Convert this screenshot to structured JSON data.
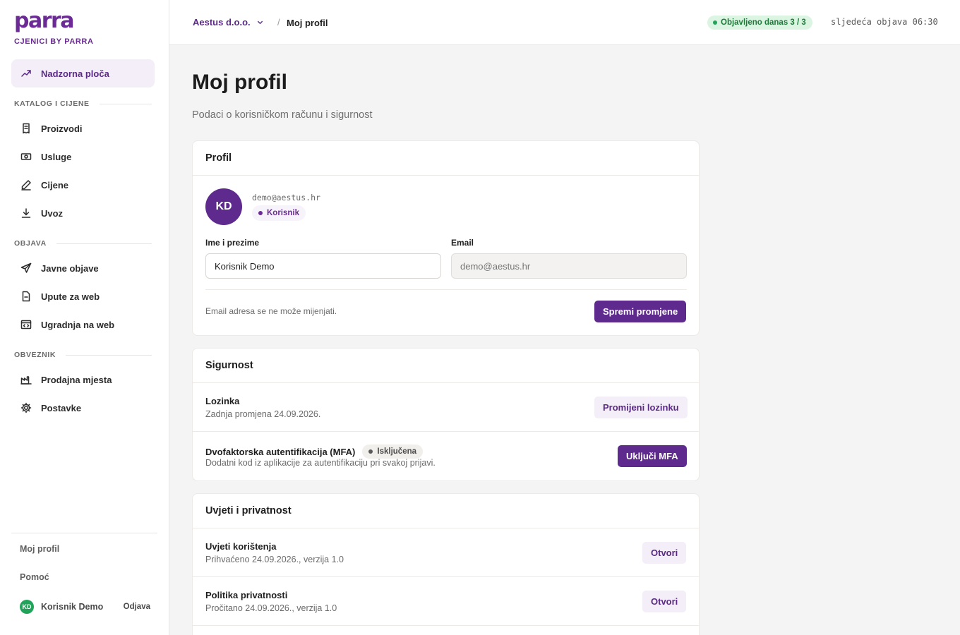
{
  "brand": {
    "logo": "parra",
    "subtitle": "CJENICI BY PARRA",
    "accent": "#5e2a8d"
  },
  "sidebar": {
    "dashboard": {
      "label": "Nadzorna ploča",
      "icon": "trend-up-icon"
    },
    "sections": [
      {
        "label": "KATALOG I CIJENE",
        "items": [
          {
            "label": "Proizvodi",
            "icon": "receipt-icon"
          },
          {
            "label": "Usluge",
            "icon": "banknote-icon"
          },
          {
            "label": "Cijene",
            "icon": "pen-icon"
          },
          {
            "label": "Uvoz",
            "icon": "download-icon"
          }
        ]
      },
      {
        "label": "OBJAVA",
        "items": [
          {
            "label": "Javne objave",
            "icon": "send-icon"
          },
          {
            "label": "Upute za web",
            "icon": "document-icon"
          },
          {
            "label": "Ugradnja na web",
            "icon": "code-window-icon"
          }
        ]
      },
      {
        "label": "OBVEZNIK",
        "items": [
          {
            "label": "Prodajna mjesta",
            "icon": "factory-icon"
          },
          {
            "label": "Postavke",
            "icon": "gear-icon"
          }
        ]
      }
    ],
    "footer": {
      "profile_link": "Moj profil",
      "help_link": "Pomoć",
      "user_initials": "KD",
      "user_name": "Korisnik Demo",
      "logout": "Odjava"
    }
  },
  "topbar": {
    "company": "Aestus d.o.o.",
    "separator": "/",
    "breadcrumb_current": "Moj profil",
    "publish_status": "Objavljeno danas 3 / 3",
    "next_publish": "sljedeća objava 06:30"
  },
  "page": {
    "title": "Moj profil",
    "subtitle": "Podaci o korisničkom računu i sigurnost"
  },
  "profile_card": {
    "title": "Profil",
    "initials": "KD",
    "email_display": "demo@aestus.hr",
    "role": "Korisnik",
    "name_label": "Ime i prezime",
    "name_value": "Korisnik Demo",
    "email_label": "Email",
    "email_placeholder": "demo@aestus.hr",
    "hint": "Email adresa se ne može mijenjati.",
    "save_button": "Spremi promjene"
  },
  "security_card": {
    "title": "Sigurnost",
    "password_title": "Lozinka",
    "password_desc": "Zadnja promjena 24.09.2026.",
    "password_button": "Promijeni lozinku",
    "mfa_title": "Dvofaktorska autentifikacija (MFA)",
    "mfa_status": "Isključena",
    "mfa_desc": "Dodatni kod iz aplikacije za autentifikaciju pri svakoj prijavi.",
    "mfa_button": "Uključi MFA"
  },
  "terms_card": {
    "title": "Uvjeti i privatnost",
    "terms_title": "Uvjeti korištenja",
    "terms_desc": "Prihvaćeno 24.09.2026., verzija 1.0",
    "terms_button": "Otvori",
    "privacy_title": "Politika privatnosti",
    "privacy_desc": "Pročitano 24.09.2026., verzija 1.0",
    "privacy_button": "Otvori"
  }
}
